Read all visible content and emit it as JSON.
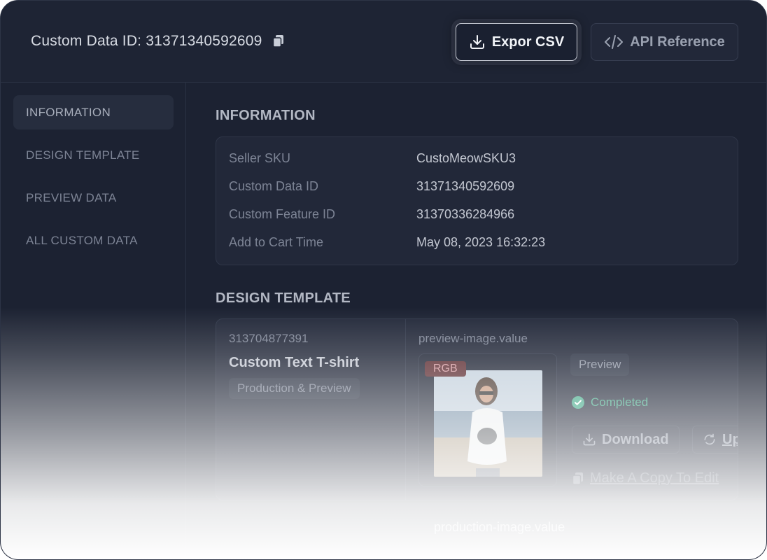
{
  "header": {
    "title": "Custom Data ID: 31371340592609",
    "export_label": "Expor CSV",
    "api_label": "API Reference"
  },
  "sidebar": {
    "items": [
      {
        "label": "INFORMATION",
        "active": true
      },
      {
        "label": "DESIGN TEMPLATE",
        "active": false
      },
      {
        "label": "PREVIEW DATA",
        "active": false
      },
      {
        "label": "ALL CUSTOM DATA",
        "active": false
      }
    ]
  },
  "information": {
    "title": "INFORMATION",
    "rows": [
      {
        "key": "Seller SKU",
        "value": "CustoMeowSKU3"
      },
      {
        "key": "Custom Data ID",
        "value": "31371340592609"
      },
      {
        "key": "Custom Feature ID",
        "value": "31370336284966"
      },
      {
        "key": "Add to Cart Time",
        "value": "May 08, 2023 16:32:23"
      }
    ]
  },
  "design_template": {
    "title": "DESIGN TEMPLATE",
    "id": "313704877391",
    "name": "Custom Text T-shirt",
    "tag": "Production & Preview",
    "field_key": "preview-image.value",
    "color_mode": "RGB",
    "preview_badge": "Preview",
    "status": "Completed",
    "download_label": "Download",
    "upload_label": "Up",
    "copy_link": "Make A Copy To Edit",
    "next_key": "production-image.value"
  },
  "colors": {
    "accent_status": "#3fa786",
    "background": "#1c2232"
  }
}
